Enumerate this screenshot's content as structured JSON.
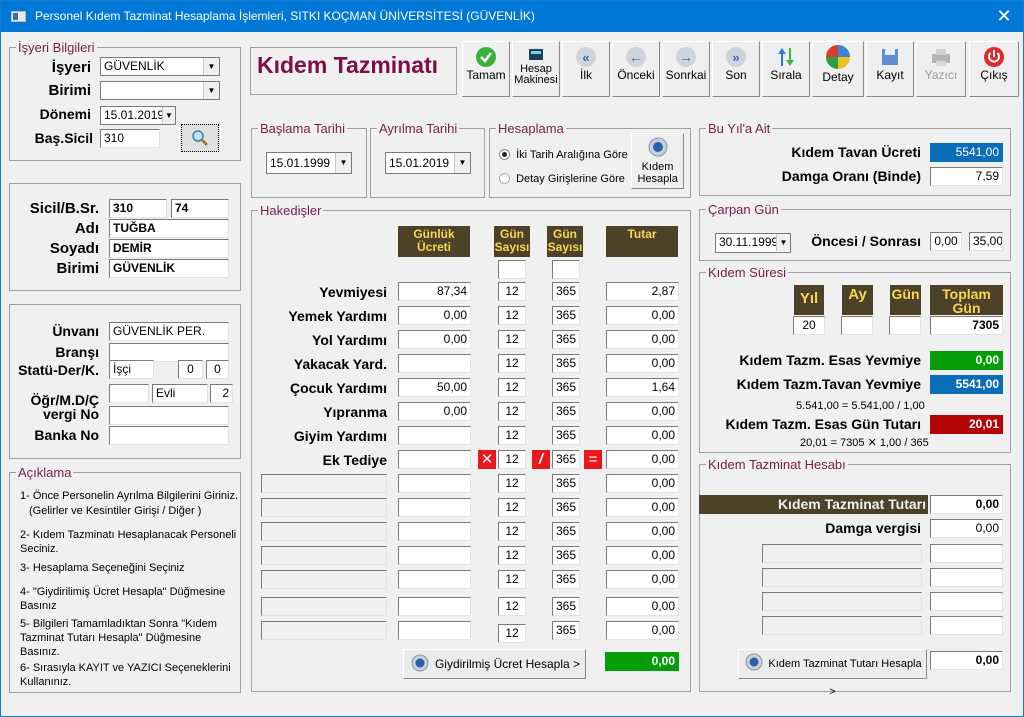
{
  "window": {
    "title": "Personel Kıdem Tazminat Hesaplama İşlemleri, SITKI KOÇMAN ÜNİVERSİTESİ  (GÜVENLİK)",
    "close": "✕"
  },
  "header_title": "Kıdem Tazminatı",
  "toolbar": [
    {
      "label": "Tamam",
      "icon": "check-icon"
    },
    {
      "label": "Hesap Makinesi",
      "icon": "calculator-icon"
    },
    {
      "label": "İlk",
      "icon": "first-icon"
    },
    {
      "label": "Önceki",
      "icon": "previous-icon"
    },
    {
      "label": "Sonrkai",
      "icon": "next-icon"
    },
    {
      "label": "Son",
      "icon": "last-icon"
    },
    {
      "label": "Sırala",
      "icon": "sort-icon"
    },
    {
      "label": "Detay",
      "icon": "detail-icon"
    },
    {
      "label": "Kayıt",
      "icon": "save-icon"
    },
    {
      "label": "Yazıcı",
      "icon": "printer-icon"
    },
    {
      "label": "Çıkış",
      "icon": "exit-icon"
    }
  ],
  "isyeri": {
    "legend": "İşyeri Bilgileri",
    "isyeri_label": "İşyeri",
    "isyeri_value": "GÜVENLİK",
    "birimi_label": "Birimi",
    "birimi_value": "",
    "donemi_label": "Dönemi",
    "donemi_value": "15.01.2019",
    "bassicil_label": "Baş.Sicil",
    "bassicil_value": "310"
  },
  "personel": {
    "sicil_label": "Sicil/B.Sr.",
    "sicil_value": "310",
    "bsr_value": "74",
    "adi_label": "Adı",
    "adi_value": "TUĞBA",
    "soyadi_label": "Soyadı",
    "soyadi_value": "DEMİR",
    "birimi_label": "Birimi",
    "birimi_value": "GÜVENLİK"
  },
  "detay": {
    "unvani_label": "Ünvanı",
    "unvani_value": "GÜVENLİK PER.",
    "bransi_label": "Branşı",
    "bransi_value": "",
    "statu_label": "Statü-Der/K.",
    "statu_value": "İşçi",
    "der_value": "0",
    "k_value": "0",
    "ogr_label": "Öğr/M.D/Ç",
    "ogr_value": "",
    "md_value": "Evli",
    "c_value": "2",
    "vergi_label": "vergi No",
    "vergi_value": "",
    "banka_label": "Banka No",
    "banka_value": ""
  },
  "aciklama": {
    "legend": "Açıklama",
    "items": [
      "1- Önce Personelin Ayrılma Bilgilerini Giriniz.",
      "(Gelirler ve Kesintiler Girişi / Diğer )",
      "2- Kıdem Tazminatı Hesaplanacak Personeli",
      "Seciniz.",
      "3- Hesaplama Seçeneğini Seçiniz",
      "4- \"Giydirilimiş Ücret Hesapla\" Düğmesine",
      "Basınız",
      "5- Bilgileri Tamamladıktan Sonra \"Kıdem",
      "Tazminat Tutarı Hesapla\" Düğmesine",
      "Basınız.",
      "6- Sırasıyla KAYIT  ve YAZICI Seçeneklerini",
      "Kullanınız."
    ]
  },
  "baslama": {
    "legend": "Başlama Tarihi",
    "value": "15.01.1999"
  },
  "ayrilma": {
    "legend": "Ayrılma Tarihi",
    "value": "15.01.2019"
  },
  "hesaplama": {
    "legend": "Hesaplama",
    "option1": "İki Tarih Aralığına Göre",
    "option2": "Detay Girişlerine Göre",
    "selected": "option1",
    "button": "Kıdem Hesapla"
  },
  "hakedisler": {
    "legend": "Hakedişler",
    "headers": {
      "gunluk": "Günlük Ücreti",
      "gun1": "Gün Sayısı",
      "gun2": "Gün Sayısı",
      "tutar": "Tutar"
    },
    "ops": {
      "mul": "✕",
      "div": "/",
      "eq": "="
    },
    "rows": [
      {
        "label": "Yevmiyesi",
        "ucret": "87,34",
        "g1": "12",
        "g2": "365",
        "tutar": "2,87"
      },
      {
        "label": "Yemek Yardımı",
        "ucret": "0,00",
        "g1": "12",
        "g2": "365",
        "tutar": "0,00"
      },
      {
        "label": "Yol Yardımı",
        "ucret": "0,00",
        "g1": "12",
        "g2": "365",
        "tutar": "0,00"
      },
      {
        "label": "Yakacak Yard.",
        "ucret": "",
        "g1": "12",
        "g2": "365",
        "tutar": "0,00"
      },
      {
        "label": "Çocuk Yardımı",
        "ucret": "50,00",
        "g1": "12",
        "g2": "365",
        "tutar": "1,64"
      },
      {
        "label": "Yıpranma",
        "ucret": "0,00",
        "g1": "12",
        "g2": "365",
        "tutar": "0,00"
      },
      {
        "label": "Giyim Yardımı",
        "ucret": "",
        "g1": "12",
        "g2": "365",
        "tutar": "0,00"
      },
      {
        "label": "Ek Tediye",
        "ucret": "",
        "g1": "12",
        "g2": "365",
        "tutar": "0,00"
      },
      {
        "label": "",
        "ucret": "",
        "g1": "12",
        "g2": "365",
        "tutar": "0,00"
      },
      {
        "label": "",
        "ucret": "",
        "g1": "12",
        "g2": "365",
        "tutar": "0,00"
      },
      {
        "label": "",
        "ucret": "",
        "g1": "12",
        "g2": "365",
        "tutar": "0,00"
      },
      {
        "label": "",
        "ucret": "",
        "g1": "12",
        "g2": "365",
        "tutar": "0,00"
      },
      {
        "label": "",
        "ucret": "",
        "g1": "12",
        "g2": "365",
        "tutar": "0,00"
      },
      {
        "label": "",
        "ucret": "",
        "g1": "12",
        "g2": "365",
        "tutar": "0,00"
      },
      {
        "label": "",
        "ucret": "",
        "g1": "12",
        "g2": "365",
        "tutar": "0,00"
      }
    ],
    "button": "Giydirilmiş Ücret Hesapla >",
    "total": "0,00"
  },
  "buyil": {
    "legend": "Bu Yıl'a Ait",
    "tavan_label": "Kıdem Tavan Ücreti",
    "tavan_value": "5541,00",
    "damga_label": "Damga Oranı (Binde)",
    "damga_value": "7,59"
  },
  "carpan": {
    "legend": "Çarpan Gün",
    "date": "30.11.1999",
    "label": "Öncesi / Sonrası",
    "oncesi": "0,00",
    "sonrasi": "35,00"
  },
  "sure": {
    "legend": "Kıdem Süresi",
    "yil_h": "Yıl",
    "ay_h": "Ay",
    "gun_h": "Gün",
    "toplam_h": "Toplam Gün",
    "yil": "20",
    "ay": "",
    "gun": "",
    "toplam": "7305",
    "esas_label": "Kıdem Tazm. Esas Yevmiye",
    "esas_value": "0,00",
    "tavan_label": "Kıdem Tazm.Tavan Yevmiye",
    "tavan_value": "5541,00",
    "formula1": "5.541,00  =  5.541,00 /  1,00",
    "gun_tutar_label": "Kıdem Tazm. Esas Gün Tutarı",
    "gun_tutar_value": "20,01",
    "formula2": "20,01  = 7305 ✕ 1,00 / 365"
  },
  "tazminat": {
    "legend": "Kıdem Tazminat Hesabı",
    "tutar_label": "Kıdem Tazminat Tutarı",
    "tutar_value": "0,00",
    "damga_label": "Damga vergisi",
    "damga_value": "0,00",
    "button": "Kıdem Tazminat Tutarı Hesapla >",
    "result": "0,00"
  },
  "colors": {
    "titlebar": "#0078d7",
    "legend": "#7a1b4a",
    "dark_header": "#4e4129",
    "header_text": "#f5d94d",
    "green": "#079d08",
    "blue": "#0a6db6",
    "red": "#b50405",
    "op_red": "#e8181e"
  }
}
